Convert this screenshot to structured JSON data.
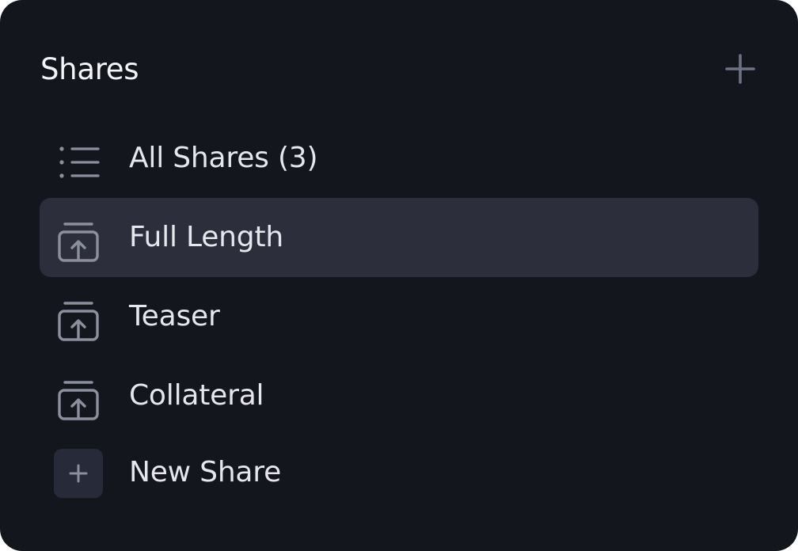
{
  "header": {
    "title": "Shares",
    "add_icon": "plus-icon"
  },
  "items": [
    {
      "label": "All Shares (3)",
      "icon": "list-icon",
      "active": false
    },
    {
      "label": "Full Length",
      "icon": "share-upload-icon",
      "active": true
    },
    {
      "label": "Teaser",
      "icon": "share-upload-icon",
      "active": false
    },
    {
      "label": "Collateral",
      "icon": "share-upload-icon",
      "active": false
    }
  ],
  "new_share": {
    "label": "New Share",
    "icon": "plus-icon"
  },
  "colors": {
    "background": "#14161e",
    "active_item": "#2c2e3c",
    "icon": "#8c8f9e",
    "text": "#e6e7ec"
  }
}
